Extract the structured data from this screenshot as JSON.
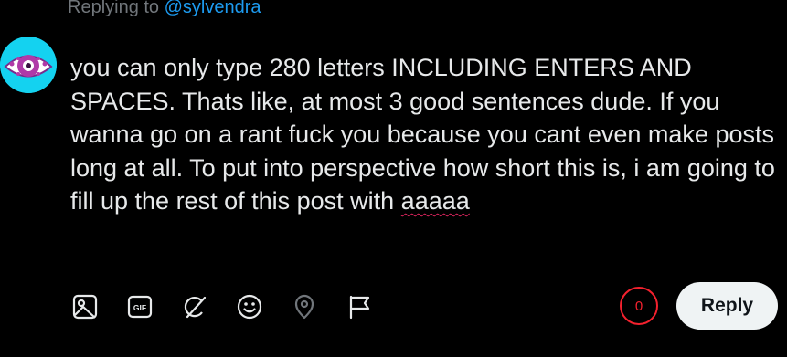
{
  "reply_context": {
    "prefix": "Replying to ",
    "handle": "@sylvendra"
  },
  "avatar": {
    "icon": "eye-avatar",
    "background": "#14d2f0"
  },
  "composer": {
    "text_before": "you can only type 280 letters INCLUDING ENTERS AND SPACES. Thats like, at most 3 good sentences dude. If you wanna go on a rant fuck you because you cant even make posts long at all. To put into perspective how short this is, i am going to fill up the rest of this post with ",
    "text_misspelled": "aaaaa"
  },
  "toolbar": {
    "icons": [
      "image-icon",
      "gif-icon",
      "grok-icon",
      "emoji-icon",
      "location-icon",
      "flag-icon"
    ],
    "gif_label": "GIF",
    "accent": "#1d9bf0"
  },
  "counter": {
    "value": "0",
    "color": "#f4212e"
  },
  "reply_button": {
    "label": "Reply"
  }
}
